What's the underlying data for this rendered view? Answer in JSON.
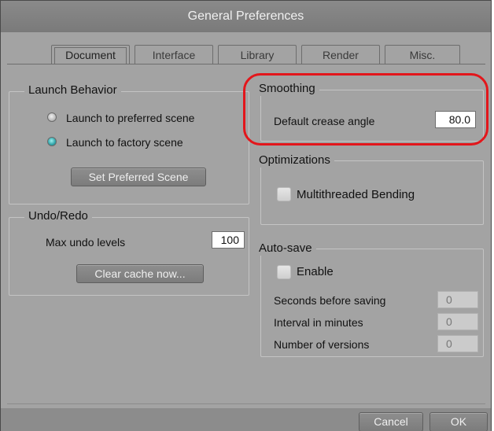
{
  "window": {
    "title": "General Preferences"
  },
  "tabs": [
    {
      "label": "Document",
      "active": true
    },
    {
      "label": "Interface",
      "active": false
    },
    {
      "label": "Library",
      "active": false
    },
    {
      "label": "Render",
      "active": false
    },
    {
      "label": "Misc.",
      "active": false
    }
  ],
  "launch": {
    "legend": "Launch Behavior",
    "option_preferred": "Launch to preferred scene",
    "option_factory": "Launch to factory scene",
    "selected": "Launch to factory scene",
    "button": "Set Preferred Scene"
  },
  "undo": {
    "legend": "Undo/Redo",
    "max_label": "Max undo levels",
    "max_value": "100",
    "clear_button": "Clear cache now..."
  },
  "smoothing": {
    "legend": "Smoothing",
    "crease_label": "Default crease angle",
    "crease_value": "80.0",
    "highlight_color": "#e3161b"
  },
  "optimizations": {
    "legend": "Optimizations",
    "multithreaded_label": "Multithreaded Bending",
    "multithreaded_checked": false
  },
  "autosave": {
    "legend": "Auto-save",
    "enable_label": "Enable",
    "enable_checked": false,
    "seconds_label": "Seconds before saving",
    "seconds_value": "0",
    "interval_label": "Interval in minutes",
    "interval_value": "0",
    "versions_label": "Number of versions",
    "versions_value": "0"
  },
  "footer": {
    "cancel": "Cancel",
    "ok": "OK"
  }
}
